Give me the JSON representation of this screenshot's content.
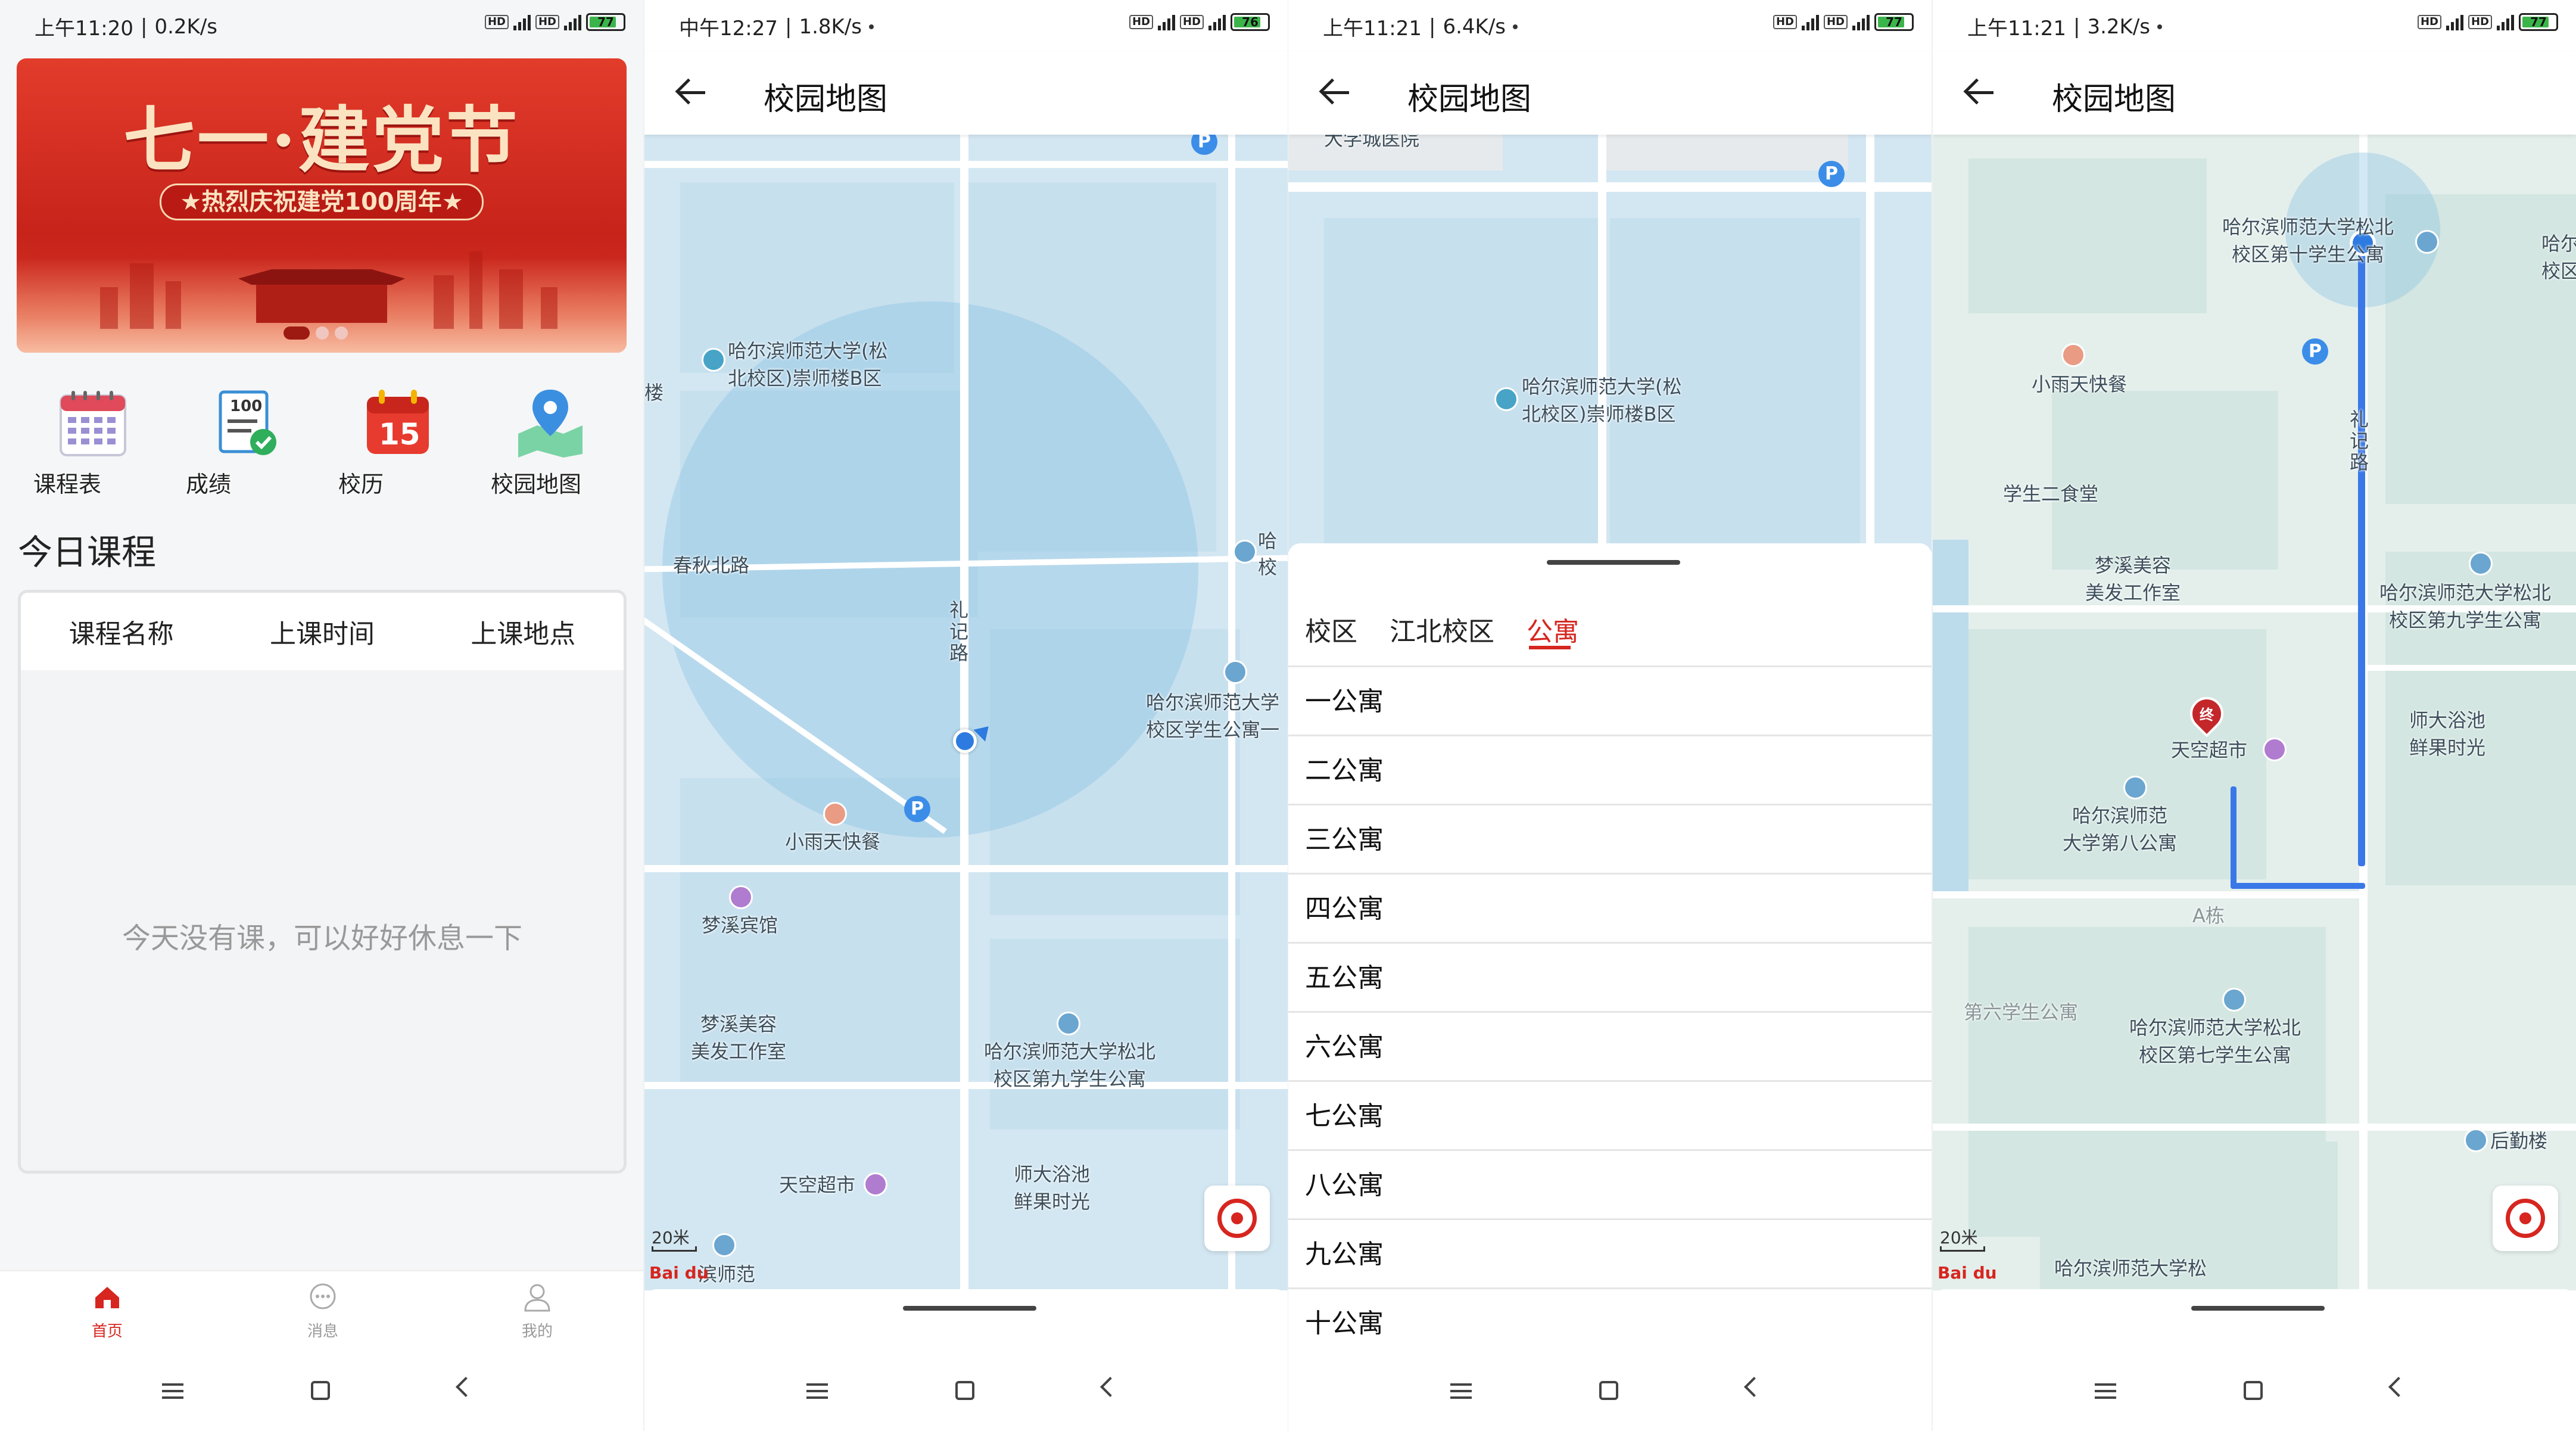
{
  "screen1": {
    "status": {
      "time": "上午11:20",
      "speed": "0.2K/s",
      "battery": "77"
    },
    "banner": {
      "title": "七一·建党节",
      "subtitle": "★热烈庆祝建党100周年★"
    },
    "grid": [
      {
        "label": "课程表",
        "icon": "calendar-grid-icon"
      },
      {
        "label": "成绩",
        "icon": "score-report-icon"
      },
      {
        "label": "校历",
        "icon": "calendar-15-icon"
      },
      {
        "label": "校园地图",
        "icon": "map-pin-icon"
      }
    ],
    "section_title": "今日课程",
    "table_headers": [
      "课程名称",
      "上课时间",
      "上课地点"
    ],
    "empty_text": "今天没有课，可以好好休息一下",
    "tabs": [
      {
        "label": "首页",
        "icon": "home-icon"
      },
      {
        "label": "消息",
        "icon": "chat-icon"
      },
      {
        "label": "我的",
        "icon": "user-icon"
      }
    ]
  },
  "screen2": {
    "status": {
      "time": "中午12:27",
      "speed": "1.8K/s",
      "battery": "76"
    },
    "title": "校园地图",
    "map_labels": {
      "chongshi": "哈尔滨师范大学(松\n北校区)崇师楼B区",
      "chunqiu": "春秋北路",
      "lijilu": "礼\n记\n路",
      "dorm_right": "哈尔滨师范大学\n校区学生公寓一",
      "xiaoyutian": "小雨天快餐",
      "mengxi_hotel": "梦溪宾馆",
      "mengxi_beauty": "梦溪美容\n美发工作室",
      "dorm9": "哈尔滨师范大学松北\n校区第九学生公寓",
      "tiankong": "天空超市",
      "bath": "师大浴池\n鲜果时光",
      "ha_edge": "哈\n校",
      "bottom": "滨师范",
      "lou": "楼",
      "scale": "20米",
      "logo": "Bai du"
    }
  },
  "screen3": {
    "status": {
      "time": "上午11:21",
      "speed": "6.4K/s",
      "battery": "77"
    },
    "title": "校园地图",
    "map_labels": {
      "top": "大学城医院",
      "chongshi": "哈尔滨师范大学(松\n北校区)崇师楼B区"
    },
    "tabs": [
      "校区",
      "江北校区",
      "公寓"
    ],
    "active_tab": "公寓",
    "items": [
      "一公寓",
      "二公寓",
      "三公寓",
      "四公寓",
      "五公寓",
      "六公寓",
      "七公寓",
      "八公寓",
      "九公寓",
      "十公寓"
    ]
  },
  "screen4": {
    "status": {
      "time": "上午11:21",
      "speed": "3.2K/s",
      "battery": "77"
    },
    "title": "校园地图",
    "map_labels": {
      "dorm10": "哈尔滨师范大学松北\n校区第十学生公寓",
      "ha_edge": "哈尔\n校区",
      "xiaoyutian": "小雨天快餐",
      "lijilu": "礼\n记\n路",
      "canteen2": "学生二食堂",
      "mengxi_beauty": "梦溪美容\n美发工作室",
      "dorm9": "哈尔滨师范大学松北\n校区第九学生公寓",
      "bath": "师大浴池\n鲜果时光",
      "tiankong": "天空超市",
      "end_marker": "终",
      "dorm8": "哈尔滨师范\n大学第八公寓",
      "a_building": "A栋",
      "dorm6": "第六学生公寓",
      "dorm7": "哈尔滨师范大学松北\n校区第七学生公寓",
      "logistics": "后勤楼",
      "bottom": "哈尔滨师范大学松",
      "scale": "20米",
      "logo": "Bai du"
    }
  }
}
